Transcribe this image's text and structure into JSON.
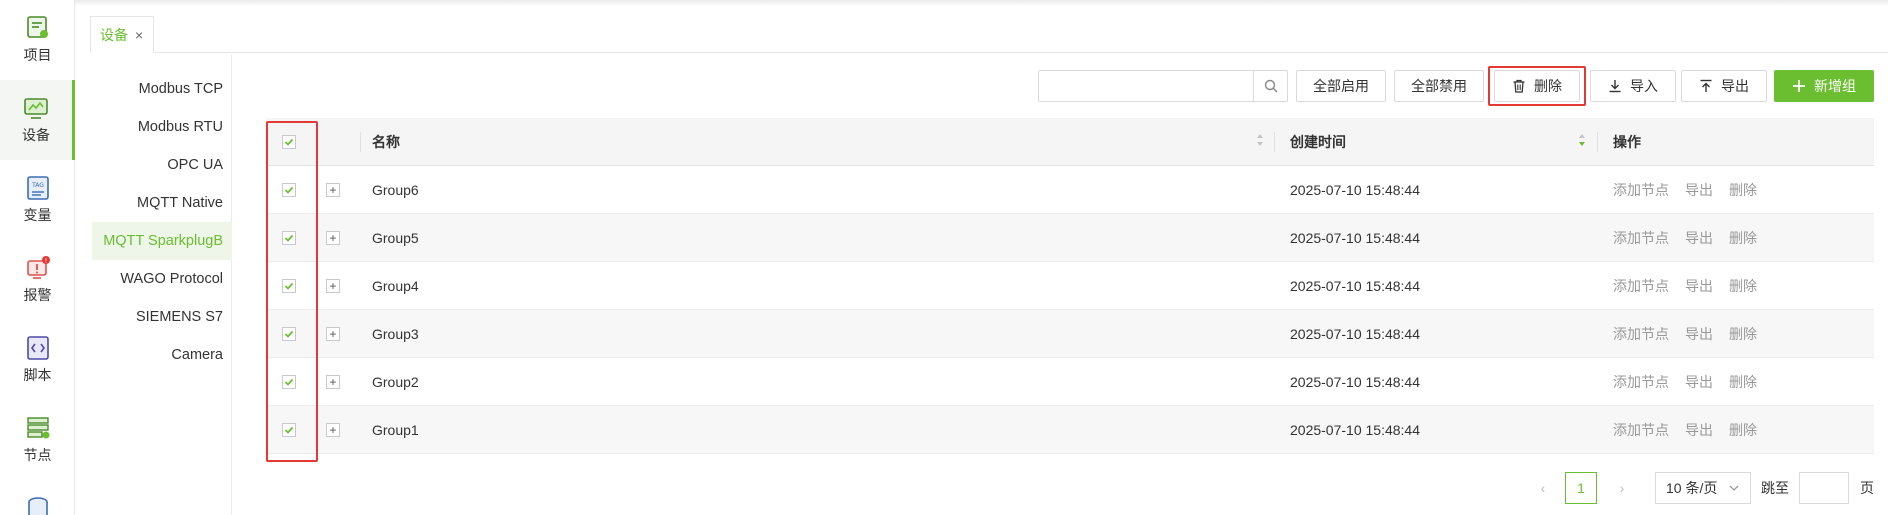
{
  "nav": {
    "items": [
      {
        "label": "项目",
        "icon": "project-icon"
      },
      {
        "label": "设备",
        "icon": "device-icon",
        "active": true
      },
      {
        "label": "变量",
        "icon": "tag-variable-icon"
      },
      {
        "label": "报警",
        "icon": "alarm-icon"
      },
      {
        "label": "脚本",
        "icon": "script-icon"
      },
      {
        "label": "节点",
        "icon": "node-icon"
      },
      {
        "label": "",
        "icon": "database-icon"
      }
    ]
  },
  "tabs": [
    {
      "label": "设备",
      "close": "×"
    }
  ],
  "protocols": {
    "items": [
      "Modbus TCP",
      "Modbus RTU",
      "OPC UA",
      "MQTT Native",
      "MQTT SparkplugB",
      "WAGO Protocol",
      "SIEMENS S7",
      "Camera"
    ],
    "active": "MQTT SparkplugB"
  },
  "toolbar": {
    "search_placeholder": "",
    "enable_all": "全部启用",
    "disable_all": "全部禁用",
    "delete": "删除",
    "import": "导入",
    "export": "导出",
    "add_group": "新增组"
  },
  "table": {
    "columns": {
      "name": "名称",
      "created": "创建时间",
      "ops": "操作"
    },
    "rows": [
      {
        "name": "Group6",
        "created": "2025-07-10 15:48:44"
      },
      {
        "name": "Group5",
        "created": "2025-07-10 15:48:44"
      },
      {
        "name": "Group4",
        "created": "2025-07-10 15:48:44"
      },
      {
        "name": "Group3",
        "created": "2025-07-10 15:48:44"
      },
      {
        "name": "Group2",
        "created": "2025-07-10 15:48:44"
      },
      {
        "name": "Group1",
        "created": "2025-07-10 15:48:44"
      }
    ],
    "row_actions": {
      "add_node": "添加节点",
      "export": "导出",
      "delete": "删除"
    },
    "expand_symbol": "+"
  },
  "pagination": {
    "prev": "‹",
    "current": "1",
    "next": "›",
    "page_size": "10 条/页",
    "jump_to": "跳至",
    "page_suffix": "页"
  },
  "colors": {
    "accent": "#6abe30",
    "highlight": "#e53935"
  }
}
